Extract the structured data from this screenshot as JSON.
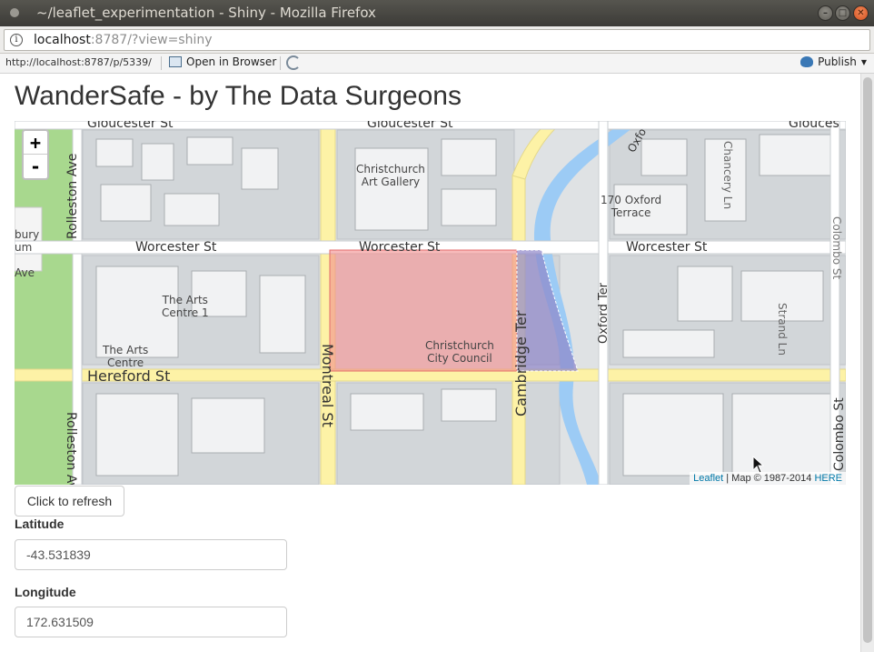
{
  "window": {
    "title": "~/leaflet_experimentation - Shiny - Mozilla Firefox"
  },
  "urlbar": {
    "host": "localhost",
    "path": ":8787/?view=shiny"
  },
  "viewer": {
    "address": "http://localhost:8787/p/5339/",
    "open_browser_label": "Open in Browser",
    "publish_label": "Publish"
  },
  "app": {
    "title": "WanderSafe - by The Data Surgeons",
    "refresh_label": "Click to refresh",
    "latitude_label": "Latitude",
    "latitude_value": "-43.531839",
    "longitude_label": "Longitude",
    "longitude_value": "172.631509"
  },
  "map": {
    "zoom_in": "+",
    "zoom_out": "-",
    "attribution_link": "Leaflet",
    "attribution_text": " | Map © 1987-2014 ",
    "attribution_here": "HERE",
    "streets": {
      "gloucester_1": "Gloucester St",
      "gloucester_2": "Gloucester St",
      "gloucester_3": "Glouces",
      "worcester_1": "Worcester St",
      "worcester_2": "Worcester St",
      "worcester_3": "Worcester St",
      "hereford": "Hereford St",
      "rolleston_1": "Rolleston Ave",
      "rolleston_2": "Rolleston Av",
      "montreal": "Montreal St",
      "cambridge": "Cambridge Ter",
      "oxford_ter": "Oxford Ter",
      "oxford_top": "Oxfo",
      "chancery": "Chancery Ln",
      "colombo_1": "Colombo St",
      "colombo_2": "Colombo St",
      "strand": "Strand Ln"
    },
    "pois": {
      "art_gallery_1": "Christchurch",
      "art_gallery_2": "Art Gallery",
      "terrace_1": "170 Oxford",
      "terrace_2": "Terrace",
      "arts_centre1_1": "The Arts",
      "arts_centre1_2": "Centre 1",
      "arts_centre_1": "The Arts",
      "arts_centre_2": "Centre",
      "council_1": "Christchurch",
      "council_2": "City Council",
      "museum_1": "bury",
      "museum_2": "um",
      "ave": "Ave"
    },
    "colors": {
      "highlight": "#f28c8c",
      "river": "#9ccbf5",
      "park": "#a8d88e",
      "road_major": "#fdf2a6"
    }
  }
}
